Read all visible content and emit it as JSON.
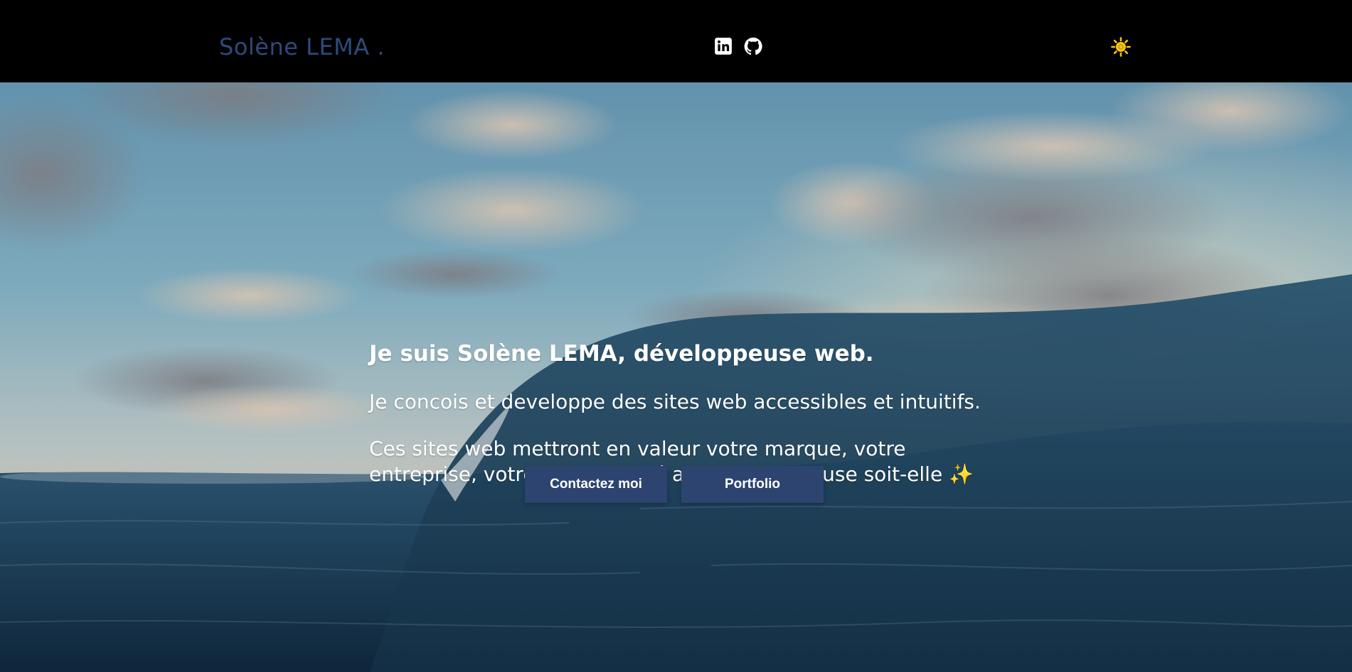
{
  "header": {
    "brand": "Solène LEMA .",
    "social_links": [
      {
        "name": "linkedin",
        "icon": "linkedin-icon"
      },
      {
        "name": "github",
        "icon": "github-icon"
      }
    ],
    "theme_toggle": {
      "icon": "sun-icon",
      "color": "#f5c518"
    }
  },
  "hero": {
    "title": "Je suis Solène LEMA, développeuse web.",
    "paragraph_1": "Je concois et developpe des sites web accessibles et intuitifs.",
    "paragraph_2": "Ces sites web mettront en valeur votre marque, votre entreprise, votre personnalité aussi merveilleuse soit-elle",
    "sparkle": "✨",
    "background_description_icon": "ocean-wave-image",
    "buttons": {
      "contact": "Contactez moi",
      "portfolio": "Portfolio"
    }
  },
  "colors": {
    "brand": "#2f4a7a",
    "button_bg": "#2d4470",
    "header_bg": "#000000",
    "sun": "#f5c518"
  }
}
